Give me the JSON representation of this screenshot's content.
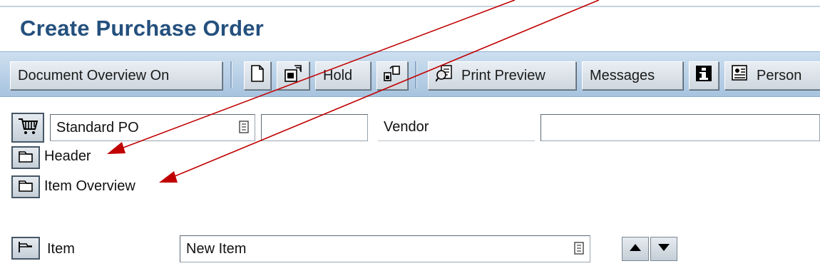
{
  "page": {
    "title": "Create Purchase Order"
  },
  "toolbar": {
    "document_overview": "Document Overview On",
    "hold": "Hold",
    "print_preview": "Print Preview",
    "messages": "Messages",
    "personal": "Person"
  },
  "header_area": {
    "order_type": "Standard PO",
    "order_number": "",
    "vendor_label": "Vendor",
    "vendor_value": ""
  },
  "sections": {
    "header": "Header",
    "item_overview": "Item Overview"
  },
  "item_selector": {
    "label": "Item",
    "value": "New Item"
  },
  "colors": {
    "title": "#24507d",
    "toolbar": "#b9d0e6",
    "annotation_arrow": "#c00000"
  }
}
